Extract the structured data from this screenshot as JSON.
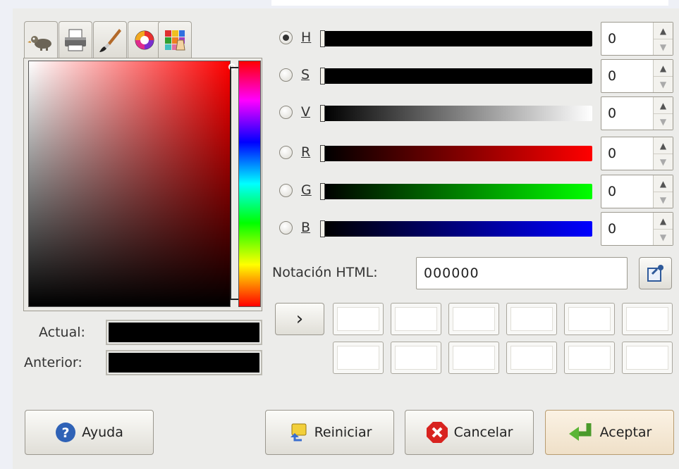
{
  "tabs": [
    {
      "name": "gimp-tab-icon"
    },
    {
      "name": "printer-tab-icon"
    },
    {
      "name": "brush-tab-icon"
    },
    {
      "name": "color-wheel-tab-icon"
    },
    {
      "name": "palette-tab-icon"
    }
  ],
  "swatches": {
    "current_label": "Actual:",
    "previous_label": "Anterior:",
    "current_color": "#000000",
    "previous_color": "#000000"
  },
  "sliders": [
    {
      "label": "H",
      "value": "0",
      "selected": true
    },
    {
      "label": "S",
      "value": "0",
      "selected": false
    },
    {
      "label": "V",
      "value": "0",
      "selected": false
    },
    {
      "label": "R",
      "value": "0",
      "selected": false
    },
    {
      "label": "G",
      "value": "0",
      "selected": false
    },
    {
      "label": "B",
      "value": "0",
      "selected": false
    }
  ],
  "html_notation": {
    "label": "Notación HTML:",
    "value": "000000"
  },
  "history": {
    "expand_label": "›"
  },
  "buttons": {
    "help": "Ayuda",
    "reset": "Reiniciar",
    "cancel": "Cancelar",
    "accept": "Aceptar"
  },
  "colors": {
    "slider_h": "#000000",
    "slider_r_end": "#ff0000",
    "slider_g_end": "#00ff00",
    "slider_b_end": "#0000ff"
  }
}
